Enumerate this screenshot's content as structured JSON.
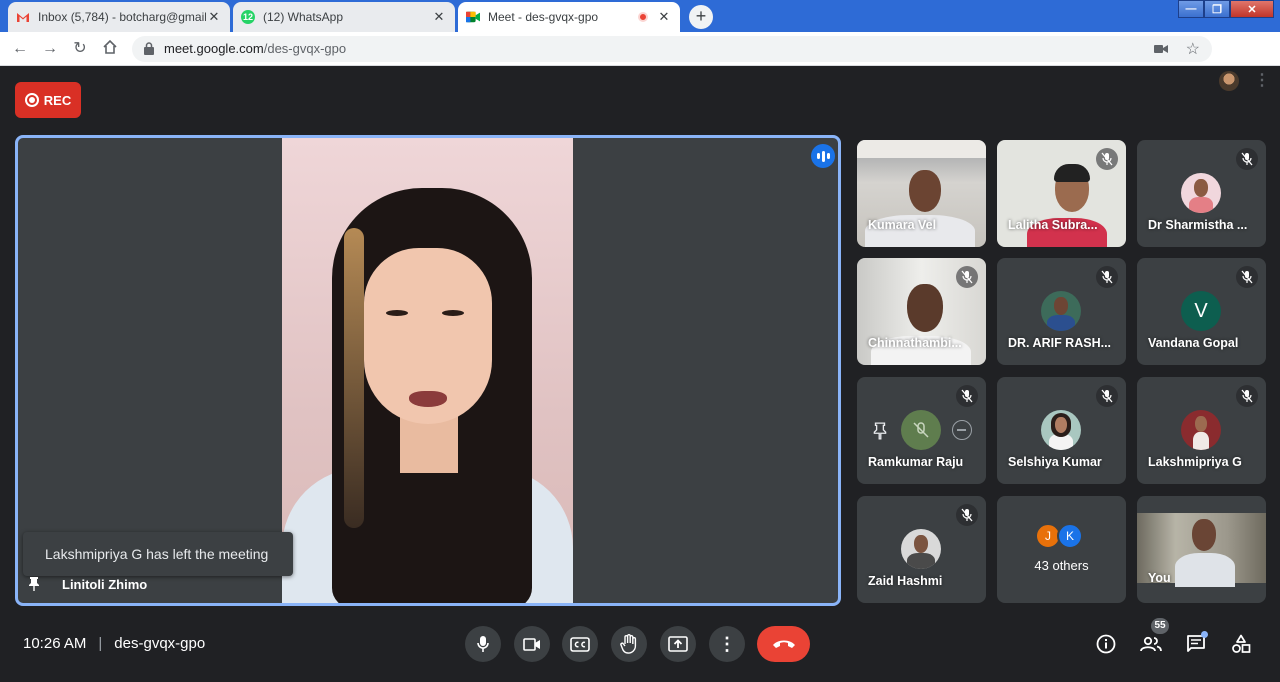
{
  "browser": {
    "tabs": [
      {
        "title": "Inbox (5,784) - botcharg@gmail.c",
        "icon": "gmail-icon"
      },
      {
        "title": "(12) WhatsApp",
        "icon": "whatsapp-icon"
      },
      {
        "title": "Meet - des-gvqx-gpo",
        "icon": "meet-icon"
      }
    ],
    "url_host": "meet.google.com",
    "url_path": "/des-gvqx-gpo"
  },
  "meet": {
    "rec_label": "REC",
    "main_speaker": "Linitoli Zhimo",
    "toast": "Lakshmipriya G has left the meeting",
    "participants": [
      {
        "name": "Kumara Vel",
        "muted": false
      },
      {
        "name": "Lalitha Subra...",
        "muted": true
      },
      {
        "name": "Dr Sharmistha ...",
        "muted": true
      },
      {
        "name": "Chinnathambi...",
        "muted": true
      },
      {
        "name": "DR. ARIF RASH...",
        "muted": true
      },
      {
        "name": "Vandana Gopal",
        "muted": true,
        "initial": "V"
      },
      {
        "name": "Ramkumar Raju",
        "muted": true
      },
      {
        "name": "Selshiya Kumar",
        "muted": true
      },
      {
        "name": "Lakshmipriya G",
        "muted": true
      },
      {
        "name": "Zaid Hashmi",
        "muted": true
      },
      {
        "name": "You",
        "muted": false
      }
    ],
    "others": {
      "initials": [
        "J",
        "K"
      ],
      "label": "43 others"
    },
    "time": "10:26 AM",
    "meeting_code": "des-gvqx-gpo",
    "people_count": "55"
  },
  "colors": {
    "accent": "#8ab4f8",
    "record": "#d93025",
    "hangup": "#ea4335",
    "background": "#202124",
    "tile": "#3c4043"
  }
}
